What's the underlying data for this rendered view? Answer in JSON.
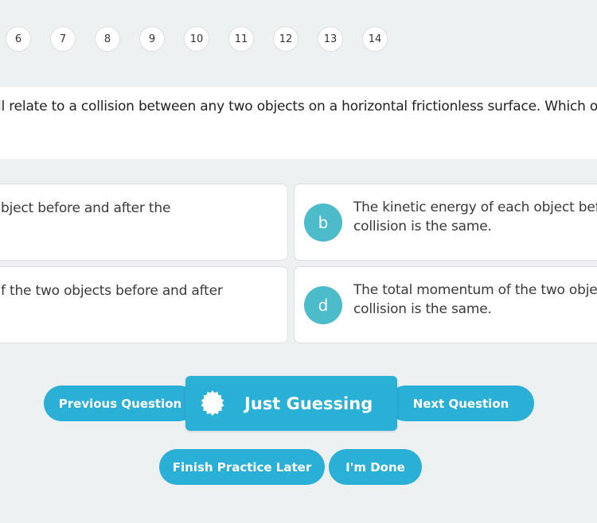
{
  "question_nav": [
    {
      "label": "6"
    },
    {
      "label": "7"
    },
    {
      "label": "8"
    },
    {
      "label": "9"
    },
    {
      "label": "10"
    },
    {
      "label": "11"
    },
    {
      "label": "12"
    },
    {
      "label": "13"
    },
    {
      "label": "14"
    }
  ],
  "question": {
    "text": "ll relate to a collision between any two objects on a horizontal frictionless surface. Which of th"
  },
  "answers": {
    "a": {
      "line1": "bject before and after the",
      "line2": ""
    },
    "b": {
      "letter": "b",
      "line1": "The kinetic energy of each object befo",
      "line2": "collision is the same."
    },
    "c": {
      "line1": "f the two objects before and after",
      "line2": ""
    },
    "d": {
      "letter": "d",
      "line1": "The total momentum of the two object",
      "line2": "collision is the same."
    }
  },
  "buttons": {
    "previous": "Previous Question",
    "guess": "Just Guessing",
    "next": "Next Question",
    "finish_later": "Finish Practice Later",
    "done": "I'm Done"
  },
  "colors": {
    "accent": "#2aafd6",
    "letter_badge": "#4cbcca",
    "background": "#eef1f2"
  }
}
